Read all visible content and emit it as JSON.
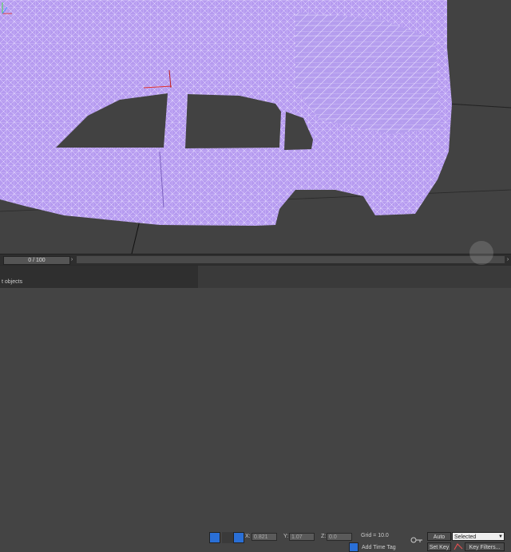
{
  "viewport": {
    "mesh_color": "#b69bf0",
    "wire_color": "#e6dcff",
    "background": "#424242"
  },
  "timeline": {
    "frame_display": "0 / 100",
    "prev_icon": "chevron-left-icon",
    "next_icon": "chevron-right-icon"
  },
  "status": {
    "selection_text": "t objects",
    "x_label": "X:",
    "x_value": "0.821",
    "y_label": "Y:",
    "y_value": "1.07",
    "z_label": "Z:",
    "z_value": "0.0",
    "grid_text": "Grid = 10.0",
    "add_time_tag": "Add Time Tag",
    "auto_key": "Auto Key",
    "set_key": "Set Key",
    "selected_option": "Selected",
    "key_filters": "Key Filters..."
  },
  "colors": {
    "accent_blue": "#2a6fd6",
    "status_bg": "#3a3a3a"
  }
}
